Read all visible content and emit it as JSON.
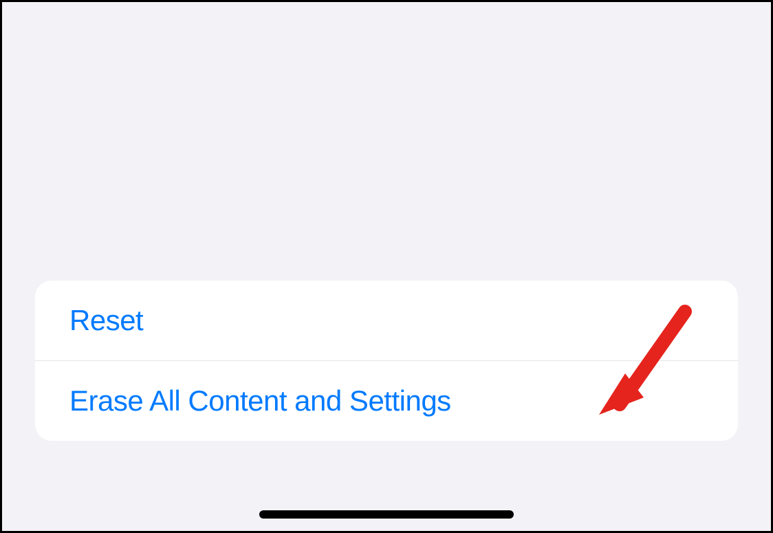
{
  "settings": {
    "rows": [
      {
        "label": "Reset"
      },
      {
        "label": "Erase All Content and Settings"
      }
    ]
  },
  "colors": {
    "link": "#007aff",
    "annotation": "#e5241d"
  }
}
